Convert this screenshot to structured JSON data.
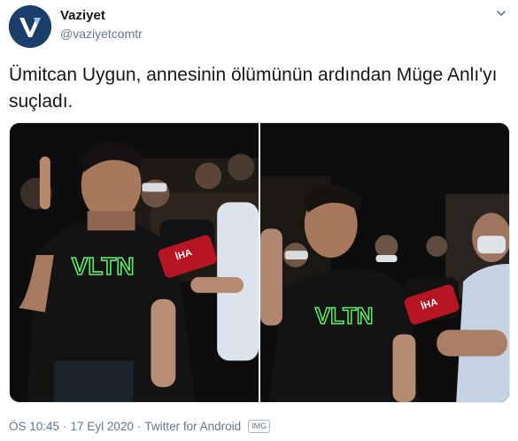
{
  "account": {
    "name": "Vaziyet",
    "handle": "@vaziyetcomtr",
    "avatar_icon": "vaziyet-logo",
    "brand_color": "#1b3f6b"
  },
  "tweet": {
    "text": "Ümitcan Uygun, annesinin ölümünün ardından Müge Anlı'yı suçladı."
  },
  "media": {
    "count": 2,
    "photos": [
      {
        "shirt_text": "VLTN",
        "mic_text": "İHA"
      },
      {
        "shirt_text": "VLTN",
        "mic_text": "İHA"
      }
    ]
  },
  "footer": {
    "time": "ÖS 10:45",
    "separator": "·",
    "date": "17 Eyl 2020",
    "source": "Twitter for Android",
    "badge": "IMG"
  },
  "colors": {
    "text": "#14171a",
    "secondary": "#657786"
  }
}
